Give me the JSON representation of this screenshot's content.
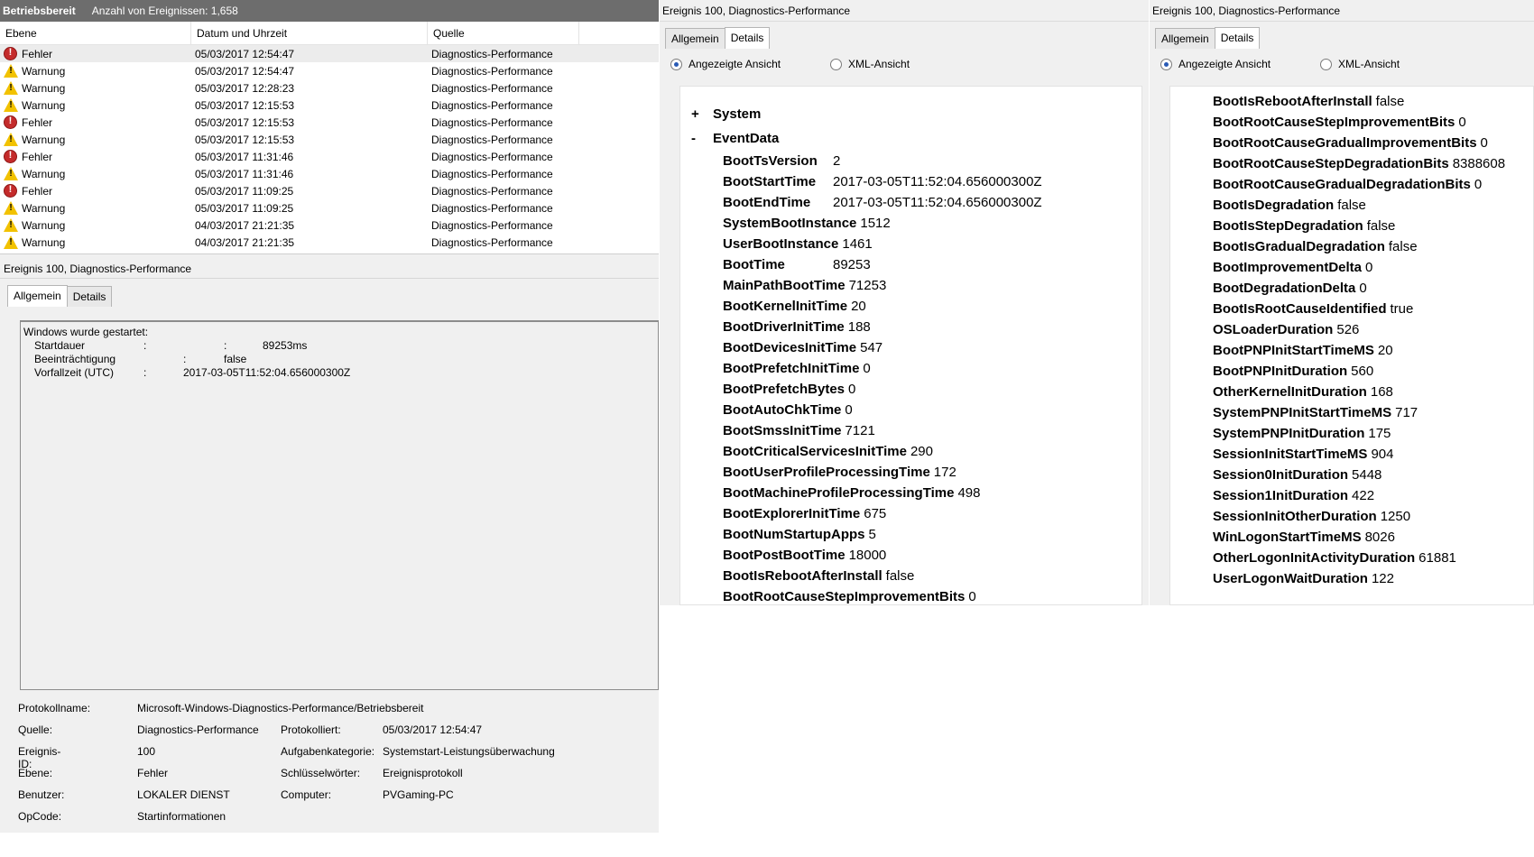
{
  "event_list": {
    "title": "Betriebsbereit",
    "count_text": "Anzahl von Ereignissen: 1,658",
    "columns": [
      "Ebene",
      "Datum und Uhrzeit",
      "Quelle"
    ],
    "rows": [
      {
        "level": "Fehler",
        "icon": "error-icon",
        "datetime": "05/03/2017 12:54:47",
        "source": "Diagnostics-Performance"
      },
      {
        "level": "Warnung",
        "icon": "warning-icon",
        "datetime": "05/03/2017 12:54:47",
        "source": "Diagnostics-Performance"
      },
      {
        "level": "Warnung",
        "icon": "warning-icon",
        "datetime": "05/03/2017 12:28:23",
        "source": "Diagnostics-Performance"
      },
      {
        "level": "Warnung",
        "icon": "warning-icon",
        "datetime": "05/03/2017 12:15:53",
        "source": "Diagnostics-Performance"
      },
      {
        "level": "Fehler",
        "icon": "error-icon",
        "datetime": "05/03/2017 12:15:53",
        "source": "Diagnostics-Performance"
      },
      {
        "level": "Warnung",
        "icon": "warning-icon",
        "datetime": "05/03/2017 12:15:53",
        "source": "Diagnostics-Performance"
      },
      {
        "level": "Fehler",
        "icon": "error-icon",
        "datetime": "05/03/2017 11:31:46",
        "source": "Diagnostics-Performance"
      },
      {
        "level": "Warnung",
        "icon": "warning-icon",
        "datetime": "05/03/2017 11:31:46",
        "source": "Diagnostics-Performance"
      },
      {
        "level": "Fehler",
        "icon": "error-icon",
        "datetime": "05/03/2017 11:09:25",
        "source": "Diagnostics-Performance"
      },
      {
        "level": "Warnung",
        "icon": "warning-icon",
        "datetime": "05/03/2017 11:09:25",
        "source": "Diagnostics-Performance"
      },
      {
        "level": "Warnung",
        "icon": "warning-icon",
        "datetime": "04/03/2017 21:21:35",
        "source": "Diagnostics-Performance"
      },
      {
        "level": "Warnung",
        "icon": "warning-icon",
        "datetime": "04/03/2017 21:21:35",
        "source": "Diagnostics-Performance"
      }
    ]
  },
  "event_detail": {
    "header": "Ereignis 100, Diagnostics-Performance",
    "tabs": [
      "Allgemein",
      "Details"
    ],
    "description": {
      "headline": "Windows wurde gestartet:",
      "lines": [
        {
          "key": "Startdauer",
          "colon": ":",
          "colon2": ":",
          "value": "89253ms"
        },
        {
          "key": "Beeinträchtigung",
          "colon": ":",
          "value": "false"
        },
        {
          "key": "Vorfallzeit (UTC)",
          "colon": ":",
          "value": "2017-03-05T11:52:04.656000300Z"
        }
      ]
    },
    "properties": {
      "protokollname_label": "Protokollname:",
      "protokollname": "Microsoft-Windows-Diagnostics-Performance/Betriebsbereit",
      "quelle_label": "Quelle:",
      "quelle": "Diagnostics-Performance",
      "protokolliert_label": "Protokolliert:",
      "protokolliert": "05/03/2017 12:54:47",
      "ereignis_id_label": "Ereignis-ID:",
      "ereignis_id": "100",
      "aufgabenkategorie_label": "Aufgabenkategorie:",
      "aufgabenkategorie": "Systemstart-Leistungsüberwachung",
      "ebene_label": "Ebene:",
      "ebene": "Fehler",
      "schluesselwoerter_label": "Schlüsselwörter:",
      "schluesselwoerter": "Ereignisprotokoll",
      "benutzer_label": "Benutzer:",
      "benutzer": "LOKALER DIENST",
      "computer_label": "Computer:",
      "computer": "PVGaming-PC",
      "opcode_label": "OpCode:",
      "opcode": "Startinformationen"
    }
  },
  "details_panel_1": {
    "title": "Ereignis 100, Diagnostics-Performance",
    "tabs": [
      "Allgemein",
      "Details"
    ],
    "radio_friendly": "Angezeigte Ansicht",
    "radio_xml": "XML-Ansicht",
    "tree_system": "System",
    "tree_system_sym": "+",
    "tree_eventdata": "EventData",
    "tree_eventdata_sym": "-",
    "fields": [
      {
        "key": "BootTsVersion",
        "value": "2"
      },
      {
        "key": "BootStartTime",
        "value": "2017-03-05T11:52:04.656000300Z"
      },
      {
        "key": "BootEndTime",
        "value": "2017-03-05T11:52:04.656000300Z"
      },
      {
        "key": "SystemBootInstance",
        "value": "1512"
      },
      {
        "key": "UserBootInstance",
        "value": "1461"
      },
      {
        "key": "BootTime",
        "value": "89253"
      },
      {
        "key": "MainPathBootTime",
        "value": "71253"
      },
      {
        "key": "BootKernelInitTime",
        "value": "20"
      },
      {
        "key": "BootDriverInitTime",
        "value": "188"
      },
      {
        "key": "BootDevicesInitTime",
        "value": "547"
      },
      {
        "key": "BootPrefetchInitTime",
        "value": "0"
      },
      {
        "key": "BootPrefetchBytes",
        "value": "0"
      },
      {
        "key": "BootAutoChkTime",
        "value": "0"
      },
      {
        "key": "BootSmssInitTime",
        "value": "7121"
      },
      {
        "key": "BootCriticalServicesInitTime",
        "value": "290"
      },
      {
        "key": "BootUserProfileProcessingTime",
        "value": "172"
      },
      {
        "key": "BootMachineProfileProcessingTime",
        "value": "498"
      },
      {
        "key": "BootExplorerInitTime",
        "value": "675"
      },
      {
        "key": "BootNumStartupApps",
        "value": "5"
      },
      {
        "key": "BootPostBootTime",
        "value": "18000"
      },
      {
        "key": "BootIsRebootAfterInstall",
        "value": "false"
      },
      {
        "key": "BootRootCauseStepImprovementBits",
        "value": "0"
      }
    ]
  },
  "details_panel_2": {
    "title": "Ereignis 100, Diagnostics-Performance",
    "tabs": [
      "Allgemein",
      "Details"
    ],
    "radio_friendly": "Angezeigte Ansicht",
    "radio_xml": "XML-Ansicht",
    "fields": [
      {
        "key": "BootIsRebootAfterInstall",
        "value": "false"
      },
      {
        "key": "BootRootCauseStepImprovementBits",
        "value": "0"
      },
      {
        "key": "BootRootCauseGradualImprovementBits",
        "value": "0"
      },
      {
        "key": "BootRootCauseStepDegradationBits",
        "value": "8388608"
      },
      {
        "key": "BootRootCauseGradualDegradationBits",
        "value": "0"
      },
      {
        "key": "BootIsDegradation",
        "value": "false"
      },
      {
        "key": "BootIsStepDegradation",
        "value": "false"
      },
      {
        "key": "BootIsGradualDegradation",
        "value": "false"
      },
      {
        "key": "BootImprovementDelta",
        "value": "0"
      },
      {
        "key": "BootDegradationDelta",
        "value": "0"
      },
      {
        "key": "BootIsRootCauseIdentified",
        "value": "true"
      },
      {
        "key": "OSLoaderDuration",
        "value": "526"
      },
      {
        "key": "BootPNPInitStartTimeMS",
        "value": "20"
      },
      {
        "key": "BootPNPInitDuration",
        "value": "560"
      },
      {
        "key": "OtherKernelInitDuration",
        "value": "168"
      },
      {
        "key": "SystemPNPInitStartTimeMS",
        "value": "717"
      },
      {
        "key": "SystemPNPInitDuration",
        "value": "175"
      },
      {
        "key": "SessionInitStartTimeMS",
        "value": "904"
      },
      {
        "key": "Session0InitDuration",
        "value": "5448"
      },
      {
        "key": "Session1InitDuration",
        "value": "422"
      },
      {
        "key": "SessionInitOtherDuration",
        "value": "1250"
      },
      {
        "key": "WinLogonStartTimeMS",
        "value": "8026"
      },
      {
        "key": "OtherLogonInitActivityDuration",
        "value": "61881"
      },
      {
        "key": "UserLogonWaitDuration",
        "value": "122"
      }
    ]
  }
}
